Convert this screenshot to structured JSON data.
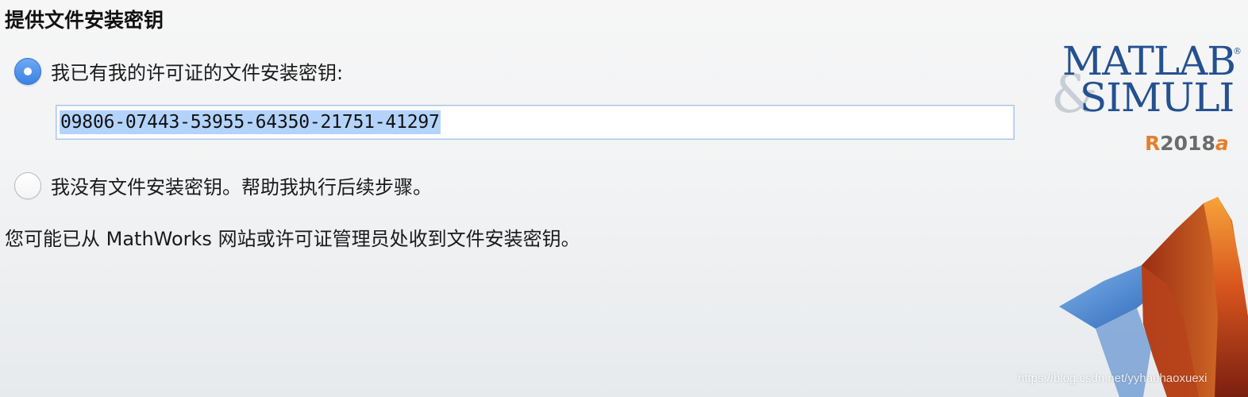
{
  "dialog": {
    "title": "提供文件安装密钥",
    "options": [
      {
        "label": "我已有我的许可证的文件安装密钥:",
        "selected": true
      },
      {
        "label": "我没有文件安装密钥。帮助我执行后续步骤。",
        "selected": false
      }
    ],
    "key_field": {
      "value": "09806-07443-53955-64350-21751-41297",
      "selected_text": true
    },
    "helper_text": "您可能已从 MathWorks 网站或许可证管理员处收到文件安装密钥。"
  },
  "branding": {
    "logo_line1": "MATLAB",
    "logo_ampersand": "&",
    "logo_line2": "SIMULI",
    "registered_mark": "®",
    "release_r": "R",
    "release_year": "2018",
    "release_suffix": "a",
    "membrane_icon": "matlab-membrane-logo",
    "colors": {
      "logo_blue": "#24518f",
      "release_orange": "#e57f2b",
      "radio_blue": "#3a82e6",
      "selection_blue": "#b3d3fb"
    }
  },
  "watermark": "https://blog.csdn.net/yyhaohaoxuexi"
}
